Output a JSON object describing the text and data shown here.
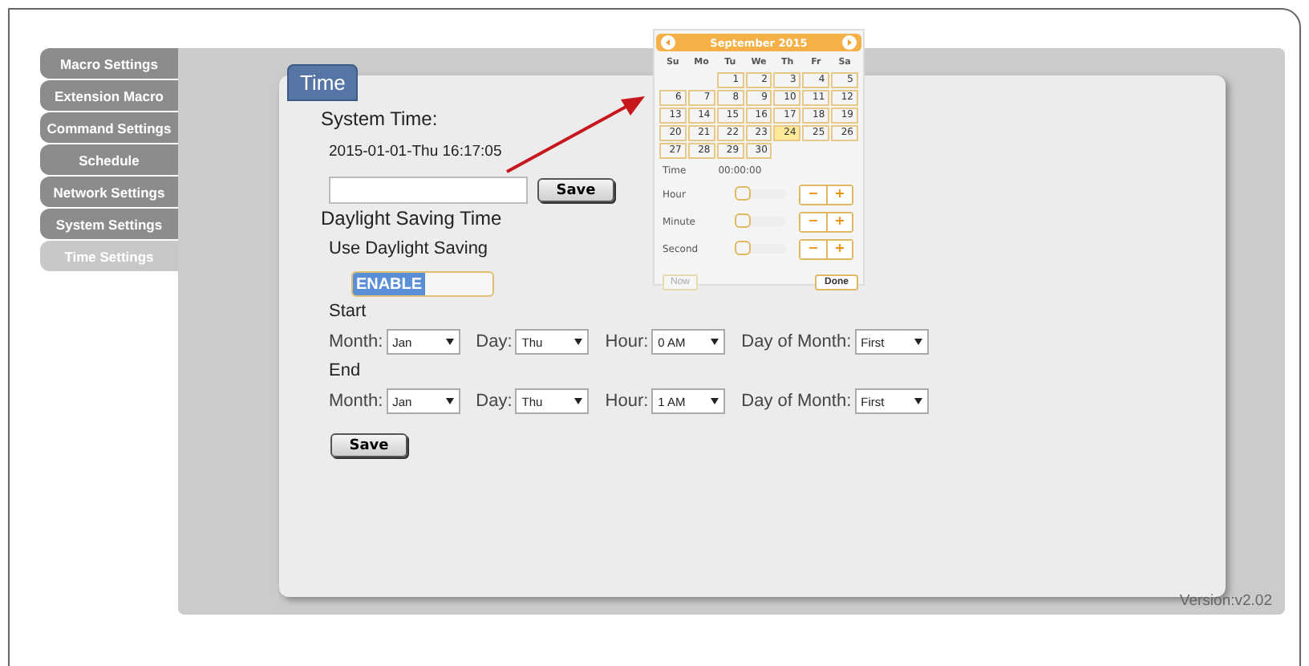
{
  "sidebar": {
    "items": [
      {
        "label": "Macro Settings",
        "selected": false
      },
      {
        "label": "Extension Macro",
        "selected": false
      },
      {
        "label": "Command Settings",
        "selected": false
      },
      {
        "label": "Schedule",
        "selected": false
      },
      {
        "label": "Network Settings",
        "selected": false
      },
      {
        "label": "System Settings",
        "selected": false
      },
      {
        "label": "Time Settings",
        "selected": true
      }
    ]
  },
  "panel": {
    "tab": "Time",
    "system_time": {
      "heading": "System Time:",
      "value": "2015-01-01-Thu 16:17:05",
      "save": "Save"
    },
    "dst": {
      "heading": "Daylight Saving Time",
      "use_label": "Use Daylight Saving",
      "toggle": {
        "label": "ENABLE",
        "on": true
      },
      "sections": [
        {
          "heading": "Start",
          "fields": [
            {
              "label": "Month:",
              "value": "Jan"
            },
            {
              "label": "Day:",
              "value": "Thu"
            },
            {
              "label": "Hour:",
              "value": "0 AM"
            },
            {
              "label": "Day of Month:",
              "value": "First"
            }
          ]
        },
        {
          "heading": "End",
          "fields": [
            {
              "label": "Month:",
              "value": "Jan"
            },
            {
              "label": "Day:",
              "value": "Thu"
            },
            {
              "label": "Hour:",
              "value": "1 AM"
            },
            {
              "label": "Day of Month:",
              "value": "First"
            }
          ]
        }
      ],
      "save": "Save"
    }
  },
  "version": "Version:v2.02",
  "datepicker": {
    "title": "September 2015",
    "weekdays": [
      "Su",
      "Mo",
      "Tu",
      "We",
      "Th",
      "Fr",
      "Sa"
    ],
    "weeks": [
      [
        {
          "kind": "blank"
        },
        {
          "kind": "blank"
        },
        {
          "d": "1",
          "selected": false
        },
        {
          "d": "2",
          "selected": false
        },
        {
          "d": "3",
          "selected": false
        },
        {
          "d": "4",
          "selected": false
        },
        {
          "d": "5",
          "selected": false
        }
      ],
      [
        {
          "d": "6",
          "selected": false
        },
        {
          "d": "7",
          "selected": false
        },
        {
          "d": "8",
          "selected": false
        },
        {
          "d": "9",
          "selected": false
        },
        {
          "d": "10",
          "selected": false
        },
        {
          "d": "11",
          "selected": false
        },
        {
          "d": "12",
          "selected": false
        }
      ],
      [
        {
          "d": "13",
          "selected": false
        },
        {
          "d": "14",
          "selected": false
        },
        {
          "d": "15",
          "selected": false
        },
        {
          "d": "16",
          "selected": false
        },
        {
          "d": "17",
          "selected": false
        },
        {
          "d": "18",
          "selected": false
        },
        {
          "d": "19",
          "selected": false
        }
      ],
      [
        {
          "d": "20",
          "selected": false
        },
        {
          "d": "21",
          "selected": false
        },
        {
          "d": "22",
          "selected": false
        },
        {
          "d": "23",
          "selected": false
        },
        {
          "d": "24",
          "selected": true
        },
        {
          "d": "25",
          "selected": false
        },
        {
          "d": "26",
          "selected": false
        }
      ],
      [
        {
          "d": "27",
          "selected": false
        },
        {
          "d": "28",
          "selected": false
        },
        {
          "d": "29",
          "selected": false
        },
        {
          "d": "30",
          "selected": false
        },
        {
          "kind": "blank"
        },
        {
          "kind": "blank"
        },
        {
          "kind": "blank"
        }
      ]
    ],
    "time_label": "Time",
    "time_value": "00:00:00",
    "sliders": [
      {
        "label": "Hour",
        "level": 0,
        "minus": "−",
        "plus": "+"
      },
      {
        "label": "Minute",
        "level": 0,
        "minus": "−",
        "plus": "+"
      },
      {
        "label": "Second",
        "level": 0,
        "minus": "−",
        "plus": "+"
      }
    ],
    "now": "Now",
    "done": "Done"
  }
}
